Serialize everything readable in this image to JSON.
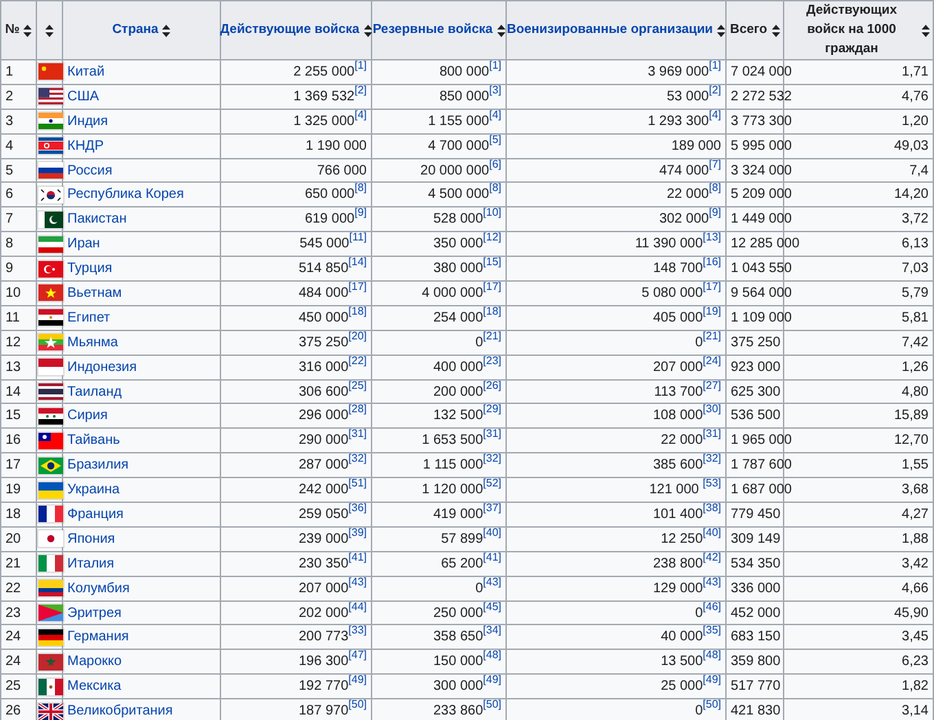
{
  "table": {
    "columns": [
      {
        "label": "№",
        "link": false,
        "sortable": true
      },
      {
        "sortable": true
      },
      {
        "label": "Страна",
        "link": true,
        "sortable": true
      },
      {
        "label": "Действующие войска",
        "link": true,
        "sortable": true
      },
      {
        "label": "Резервные войска",
        "link": true,
        "sortable": true
      },
      {
        "label": "Военизированные организации",
        "link": true,
        "sortable": true
      },
      {
        "label": "Всего",
        "link": false,
        "sortable": true
      },
      {
        "label": "Действующих войск на 1000 граждан",
        "link": false,
        "sortable": true
      }
    ],
    "rows": [
      {
        "rank": "1",
        "country": "Китай",
        "active": "2 255 000$^{[1]}$",
        "reserve": "800 000$^{[1]}$",
        "paramilitary": "3 969 000$^{[1]}$",
        "total": "7 024 000",
        "per_1000": "1,71"
      },
      {
        "rank": "2",
        "country": "США",
        "active": "1 369 532$^{[2]}$",
        "reserve": "850 000$^{[3]}$",
        "paramilitary": "53 000$^{[2]}$",
        "total": "2 272 532",
        "per_1000": "4,76"
      },
      {
        "rank": "3",
        "country": "Индия",
        "active": "1 325 000$^{[4]}$",
        "reserve": "1 155 000$^{[4]}$",
        "paramilitary": "1 293 300$^{[4]}$",
        "total": "3 773 300",
        "per_1000": "1,20"
      },
      {
        "rank": "4",
        "country": "КНДР",
        "active": "1 190 000",
        "reserve": "4 700 000$^{[5]}$",
        "paramilitary": "189 000",
        "total": "5 995 000",
        "per_1000": "49,03"
      },
      {
        "rank": "5",
        "country": "Россия",
        "active": "766 000",
        "reserve": "20 000 000$^{[6]}$",
        "paramilitary": "474 000$^{[7]}$",
        "total": "3 324 000",
        "per_1000": "7,4"
      },
      {
        "rank": "6",
        "country": "Республика Корея",
        "active": "650 000$^{[8]}$",
        "reserve": "4 500 000$^{[8]}$",
        "paramilitary": "22 000$^{[8]}$",
        "total": "5 209 000",
        "per_1000": "14,20"
      },
      {
        "rank": "7",
        "country": "Пакистан",
        "active": "619 000$^{[9]}$",
        "reserve": "528 000$^{[10]}$",
        "paramilitary": "302 000$^{[9]}$",
        "total": "1 449 000",
        "per_1000": "3,72"
      },
      {
        "rank": "8",
        "country": "Иран",
        "active": "545 000$^{[11]}$",
        "reserve": "350 000$^{[12]}$",
        "paramilitary": "11 390 000$^{[13]}$",
        "total": "12 285 000",
        "per_1000": "6,13"
      },
      {
        "rank": "9",
        "country": "Турция",
        "active": "514 850$^{[14]}$",
        "reserve": "380 000$^{[15]}$",
        "paramilitary": "148 700$^{[16]}$",
        "total": "1 043 550",
        "per_1000": "7,03"
      },
      {
        "rank": "10",
        "country": "Вьетнам",
        "active": "484 000$^{[17]}$",
        "reserve": "4 000 000$^{[17]}$",
        "paramilitary": "5 080 000$^{[17]}$",
        "total": "9 564 000",
        "per_1000": "5,79"
      },
      {
        "rank": "11",
        "country": "Египет",
        "active": "450 000$^{[18]}$",
        "reserve": "254 000$^{[18]}$",
        "paramilitary": "405 000$^{[19]}$",
        "total": "1 109 000",
        "per_1000": "5,81"
      },
      {
        "rank": "12",
        "country": "Мьянма",
        "active": "375 250$^{[20]}$",
        "reserve": "0$^{[21]}$",
        "paramilitary": "0$^{[21]}$",
        "total": "375 250",
        "per_1000": "7,42"
      },
      {
        "rank": "13",
        "country": "Индонезия",
        "active": "316 000$^{[22]}$",
        "reserve": "400 000$^{[23]}$",
        "paramilitary": "207 000$^{[24]}$",
        "total": "923 000",
        "per_1000": "1,26"
      },
      {
        "rank": "14",
        "country": "Таиланд",
        "active": "306 600$^{[25]}$",
        "reserve": "200 000$^{[26]}$",
        "paramilitary": "113 700$^{[27]}$",
        "total": "625 300",
        "per_1000": "4,80"
      },
      {
        "rank": "15",
        "country": "Сирия",
        "active": "296 000$^{[28]}$",
        "reserve": "132 500$^{[29]}$",
        "paramilitary": "108 000$^{[30]}$",
        "total": "536 500",
        "per_1000": "15,89"
      },
      {
        "rank": "16",
        "country": "Тайвань",
        "active": "290 000$^{[31]}$",
        "reserve": "1 653 500$^{[31]}$",
        "paramilitary": "22 000$^{[31]}$",
        "total": "1 965 000",
        "per_1000": "12,70"
      },
      {
        "rank": "17",
        "country": "Бразилия",
        "active": "287 000$^{[32]}$",
        "reserve": "1 115 000$^{[32]}$",
        "paramilitary": "385 600$^{[32]}$",
        "total": "1 787 600",
        "per_1000": "1,55"
      },
      {
        "rank": "19",
        "country": "Украина",
        "active": "242 000$^{[51]}$",
        "reserve": "1 120 000$^{[52]}$",
        "paramilitary": "121 000 $^{[53]}$",
        "total": "1 687 000",
        "per_1000": "3,68"
      },
      {
        "rank": "18",
        "country": "Франция",
        "active": "259 050$^{[36]}$",
        "reserve": "419 000$^{[37]}$",
        "paramilitary": "101 400$^{[38]}$",
        "total": "779 450",
        "per_1000": "4,27"
      },
      {
        "rank": "20",
        "country": "Япония",
        "active": "239 000$^{[39]}$",
        "reserve": "57 899$^{[40]}$",
        "paramilitary": "12 250$^{[40]}$",
        "total": "309 149",
        "per_1000": "1,88"
      },
      {
        "rank": "21",
        "country": "Италия",
        "active": "230 350$^{[41]}$",
        "reserve": "65 200$^{[41]}$",
        "paramilitary": "238 800$^{[42]}$",
        "total": "534 350",
        "per_1000": "3,42"
      },
      {
        "rank": "22",
        "country": "Колумбия",
        "active": "207 000$^{[43]}$",
        "reserve": "0$^{[43]}$",
        "paramilitary": "129 000$^{[43]}$",
        "total": "336 000",
        "per_1000": "4,66"
      },
      {
        "rank": "23",
        "country": "Эритрея",
        "active": "202 000$^{[44]}$",
        "reserve": "250 000$^{[45]}$",
        "paramilitary": "0$^{[46]}$",
        "total": "452 000",
        "per_1000": "45,90"
      },
      {
        "rank": "24",
        "country": "Германия",
        "active": "200 773$^{[33]}$",
        "reserve": "358 650$^{[34]}$",
        "paramilitary": "40 000$^{[35]}$",
        "total": "683 150",
        "per_1000": "3,45"
      },
      {
        "rank": "24",
        "country": "Марокко",
        "active": "196 300$^{[47]}$",
        "reserve": "150 000$^{[48]}$",
        "paramilitary": "13 500$^{[48]}$",
        "total": "359 800",
        "per_1000": "6,23"
      },
      {
        "rank": "25",
        "country": "Мексика",
        "active": "192 770$^{[49]}$",
        "reserve": "300 000$^{[49]}$",
        "paramilitary": "25 000$^{[49]}$",
        "total": "517 770",
        "per_1000": "1,82"
      },
      {
        "rank": "26",
        "country": "Великобритания",
        "active": "187 970$^{[50]}$",
        "reserve": "233 860$^{[50]}$",
        "paramilitary": "0$^{[50]}$",
        "total": "421 830",
        "per_1000": "3,14"
      }
    ]
  }
}
